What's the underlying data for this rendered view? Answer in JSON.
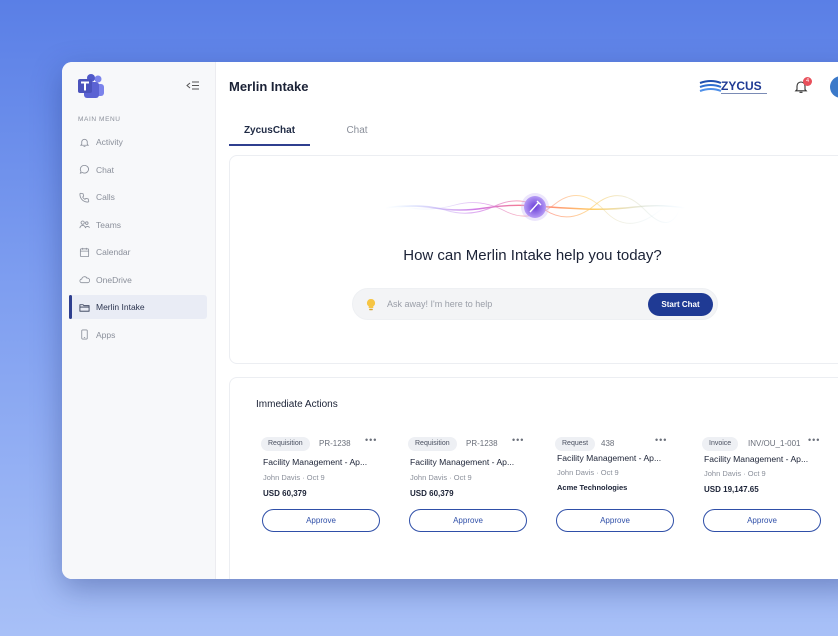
{
  "sidebar": {
    "menu_title": "MAIN MENU",
    "items": [
      {
        "label": "Activity",
        "icon": "bell-icon",
        "active": false
      },
      {
        "label": "Chat",
        "icon": "chat-bubble-icon",
        "active": false
      },
      {
        "label": "Calls",
        "icon": "phone-icon",
        "active": false
      },
      {
        "label": "Teams",
        "icon": "people-icon",
        "active": false
      },
      {
        "label": "Calendar",
        "icon": "calendar-icon",
        "active": false
      },
      {
        "label": "OneDrive",
        "icon": "cloud-icon",
        "active": false
      },
      {
        "label": "Merlin Intake",
        "icon": "folder-icon",
        "active": true
      },
      {
        "label": "Apps",
        "icon": "mobile-icon",
        "active": false
      }
    ]
  },
  "header": {
    "title": "Merlin Intake",
    "logo_text": "ZYCUS",
    "notification_count": "4"
  },
  "tabs": [
    {
      "label": "ZycusChat",
      "active": true
    },
    {
      "label": "Chat",
      "active": false
    }
  ],
  "chat": {
    "prompt": "How can Merlin Intake help you today?",
    "placeholder": "Ask away! I'm here to help",
    "start_label": "Start Chat"
  },
  "actions": {
    "title": "Immediate Actions",
    "items": [
      {
        "type": "Requisition",
        "number": "PR-1238",
        "title": "Facility Management - Ap...",
        "person": "John Davis",
        "date": "Oct 9",
        "extra": "USD 60,379",
        "button": "Approve"
      },
      {
        "type": "Requisition",
        "number": "PR-1238",
        "title": "Facility Management - Ap...",
        "person": "John Davis",
        "date": "Oct 9",
        "extra": "USD 60,379",
        "button": "Approve"
      },
      {
        "type": "Request",
        "number": "438",
        "title": "Facility Management - Ap...",
        "person": "John Davis",
        "date": "Oct 9",
        "extra": "Acme Technologies",
        "button": "Approve"
      },
      {
        "type": "Invoice",
        "number": "INV/OU_1-001",
        "title": "Facility Management - Ap...",
        "person": "John Davis",
        "date": "Oct 9",
        "extra": "USD 19,147.65",
        "button": "Approve"
      }
    ]
  },
  "colors": {
    "accent": "#1f3a94",
    "active_bar": "#2f3f8f",
    "badge": "#e8505b",
    "background_top": "#5a7fe6",
    "background_bottom": "#a8c0f7"
  }
}
